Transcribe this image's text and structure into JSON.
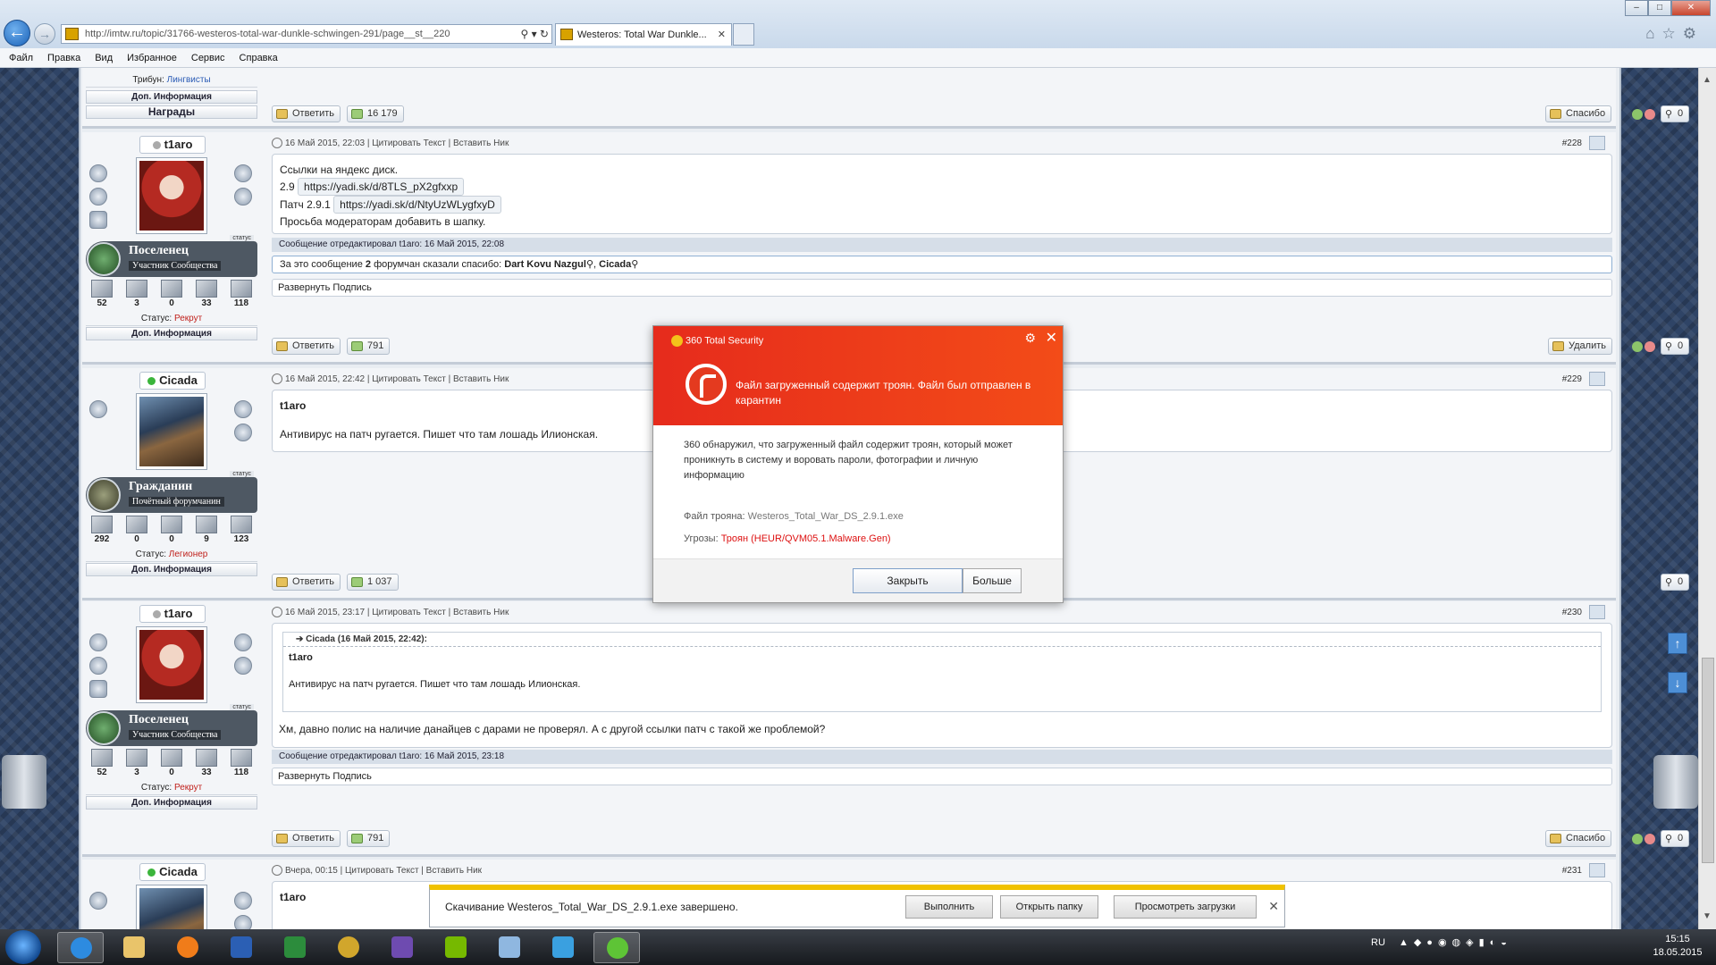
{
  "browser": {
    "address": "http://imtw.ru/topic/31766-westeros-total-war-dunkle-schwingen-291/page__st__220",
    "tab_title": "Westeros: Total War Dunkle...",
    "menu": [
      "Файл",
      "Правка",
      "Вид",
      "Избранное",
      "Сервис",
      "Справка"
    ]
  },
  "top_post_partial": {
    "tribune_label": "Трибун:",
    "tribune_value": "Лингвисты",
    "dop": "Доп. Информация",
    "awards": "Награды",
    "reply": "Ответить",
    "rep": "16 179",
    "thanks_btn": "Спасибо",
    "count": "0"
  },
  "posts": [
    {
      "nick": "t1aro",
      "rank_title": "Поселенец",
      "rank_sub": "Участник Сообщества",
      "rank_tag": "статус",
      "stats": [
        "52",
        "3",
        "0",
        "33",
        "118"
      ],
      "status_label": "Статус:",
      "status_value": "Рекрут",
      "dop": "Доп. Информация",
      "header": "16 Май 2015, 22:03 | Цитировать Текст | Вставить Ник",
      "num": "#228",
      "line1": "Ссылки на яндекс диск.",
      "l2_prefix": "2.9",
      "l2_link": "https://yadi.sk/d/8TLS_pX2gfxxp",
      "l3_prefix": "Патч 2.9.1",
      "l3_link": "https://yadi.sk/d/NtyUzWLygfxyD",
      "line4": "Просьба модераторам добавить в шапку.",
      "edited": "Сообщение отредактировал t1aro: 16 Май 2015, 22:08",
      "thanks_pre": "За это сообщение",
      "thanks_count": "2",
      "thanks_mid": "форумчан сказали спасибо:",
      "thanks_user1": "Dart Kovu Nazgul",
      "thanks_user2": "Cicada",
      "sig": "Развернуть Подпись",
      "reply": "Ответить",
      "rep": "791",
      "action": "Удалить",
      "count": "0"
    },
    {
      "nick": "Cicada",
      "rank_title": "Гражданин",
      "rank_sub": "Почётный форумчанин",
      "rank_tag": "статус",
      "stats": [
        "292",
        "0",
        "0",
        "9",
        "123"
      ],
      "status_label": "Статус:",
      "status_value": "Легионер",
      "dop": "Доп. Информация",
      "header": "16 Май 2015, 22:42 | Цитировать Текст | Вставить Ник",
      "num": "#229",
      "bold": "t1aro",
      "text": "Антивирус на патч ругается. Пишет что там лошадь Илионская.",
      "reply": "Ответить",
      "rep": "1 037",
      "count": "0"
    },
    {
      "nick": "t1aro",
      "rank_title": "Поселенец",
      "rank_sub": "Участник Сообщества",
      "rank_tag": "статус",
      "stats": [
        "52",
        "3",
        "0",
        "33",
        "118"
      ],
      "status_label": "Статус:",
      "status_value": "Рекрут",
      "dop": "Доп. Информация",
      "header": "16 Май 2015, 23:17 | Цитировать Текст | Вставить Ник",
      "num": "#230",
      "quote_head": "Cicada (16 Май 2015, 22:42):",
      "quote_bold": "t1aro",
      "quote_text": "Антивирус на патч ругается. Пишет что там лошадь Илионская.",
      "text": "Хм, давно полис на наличие данайцев с дарами не проверял. А с другой ссылки патч с такой же проблемой?",
      "edited": "Сообщение отредактировал t1aro: 16 Май 2015, 23:18",
      "sig": "Развернуть Подпись",
      "reply": "Ответить",
      "rep": "791",
      "action": "Спасибо",
      "count": "0"
    },
    {
      "nick": "Cicada",
      "header": "Вчера, 00:15 | Цитировать Текст | Вставить Ник",
      "num": "#231",
      "bold": "t1aro"
    }
  ],
  "dialog": {
    "title": "360 Total Security",
    "headline": "Файл загруженный содержит троян. Файл был отправлен в карантин",
    "desc": "360 обнаружил, что загруженный файл содержит троян, который может проникнуть в систему и воровать пароли, фотографии и личную информацию",
    "file_label": "Файл трояна:",
    "file_value": "Westeros_Total_War_DS_2.9.1.exe",
    "threat_label": "Угрозы:",
    "threat_value": "Троян (HEUR/QVM05.1.Malware.Gen)",
    "close_btn": "Закрыть",
    "more_btn": "Больше"
  },
  "download_bar": {
    "text": "Скачивание Westeros_Total_War_DS_2.9.1.exe завершено.",
    "run": "Выполнить",
    "open_folder": "Открыть папку",
    "view": "Просмотреть загрузки"
  },
  "taskbar": {
    "lang": "RU",
    "time": "15:15",
    "date": "18.05.2015"
  }
}
